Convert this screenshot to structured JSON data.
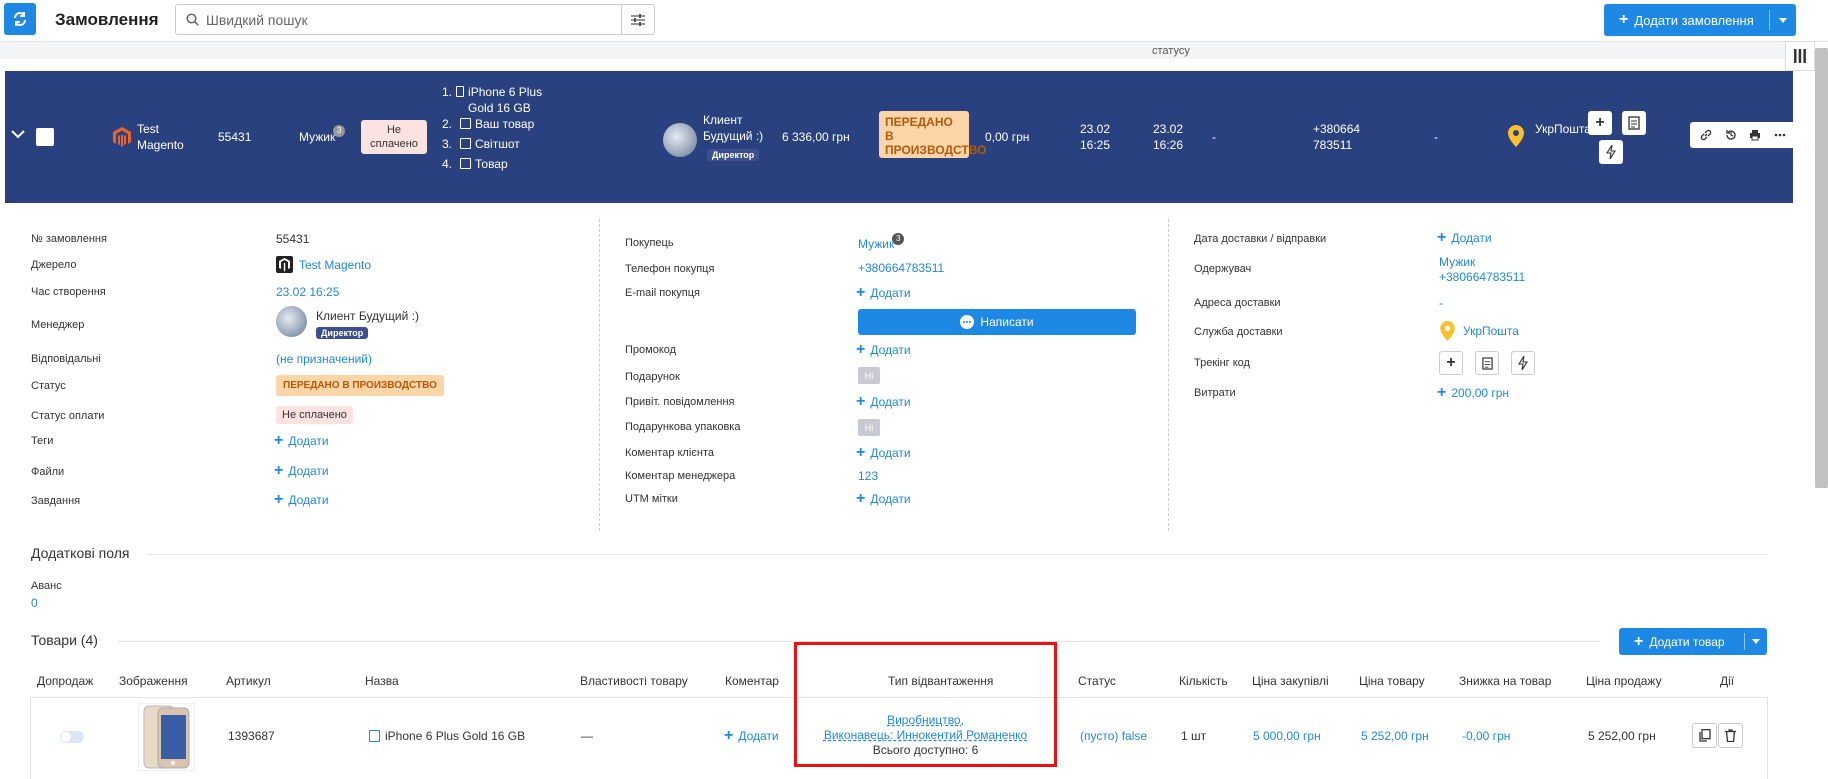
{
  "header": {
    "title": "Замовлення",
    "search_placeholder": "Швидкий пошук",
    "add_order_label": "Додати замовлення",
    "column_hint": "статусу"
  },
  "order": {
    "source": "Test Magento",
    "number": "55431",
    "customer": "Мужик",
    "customer_count": "3",
    "payment_status": "Не сплачено",
    "products": [
      {
        "n": "1.",
        "name": "iPhone 6 Plus Gold 16 GB"
      },
      {
        "n": "2.",
        "name": "Ваш товар"
      },
      {
        "n": "3.",
        "name": "Світшот"
      },
      {
        "n": "4.",
        "name": "Товар"
      }
    ],
    "manager": "Клиент Будущий :)",
    "manager_role": "Директор",
    "total": "6 336,00 грн",
    "status": "ПЕРЕДАНО В ПРОИЗВОДСТВО",
    "paid": "0,00 грн",
    "created": "23.02 16:25",
    "updated": "23.02 16:26",
    "dash1": "-",
    "phone": "+380664 783511",
    "dash2": "-",
    "delivery": "УкрПошта"
  },
  "details_left": {
    "labels": {
      "number": "№ замовлення",
      "source": "Джерело",
      "created": "Час створення",
      "manager": "Менеджер",
      "responsible": "Відповідальні",
      "status": "Статус",
      "pay_status": "Статус оплати",
      "tags": "Теги",
      "files": "Файли",
      "tasks": "Завдання"
    },
    "values": {
      "number": "55431",
      "source": "Test Magento",
      "created": "23.02 16:25",
      "manager": "Клиент Будущий :)",
      "role": "Директор",
      "responsible": "(не призначений)",
      "status": "ПЕРЕДАНО В ПРОИЗВОДСТВО",
      "pay_status": "Не сплачено",
      "add": "Додати"
    }
  },
  "details_mid": {
    "labels": {
      "buyer": "Покупець",
      "phone": "Телефон покупця",
      "email": "E-mail покупця",
      "promo": "Промокод",
      "gift": "Подарунок",
      "greeting": "Привіт. повідомлення",
      "giftwrap": "Подарункова упаковка",
      "client_comment": "Коментар клієнта",
      "manager_comment": "Коментар менеджера",
      "utm": "UTM мітки"
    },
    "values": {
      "buyer": "Мужик",
      "buyer_count": "3",
      "phone": "+380664783511",
      "add": "Додати",
      "write": "Написати",
      "no": "Ні",
      "manager_comment": "123"
    }
  },
  "details_right": {
    "labels": {
      "delivery_date": "Дата доставки / відправки",
      "recipient": "Одержувач",
      "address": "Адреса доставки",
      "service": "Служба доставки",
      "tracking": "Трекінг код",
      "costs": "Витрати"
    },
    "values": {
      "add": "Додати",
      "recipient_name": "Мужик",
      "recipient_phone": "+380664783511",
      "address": "-",
      "service": "УкрПошта",
      "costs": "200,00 грн"
    }
  },
  "extra": {
    "title": "Додаткові поля",
    "field_label": "Аванс",
    "field_value": "0"
  },
  "goods": {
    "title": "Товари (4)",
    "add_label": "Додати товар",
    "columns": [
      "Допродаж",
      "Зображення",
      "Артикул",
      "Назва",
      "Властивості товару",
      "Коментар",
      "Тип відвантаження",
      "Статус",
      "Кількість",
      "Ціна закупівлі",
      "Ціна товару",
      "Знижка на товар",
      "Ціна продажу",
      "Дії"
    ],
    "row": {
      "sku": "1393687",
      "name": "iPhone 6 Plus Gold 16 GB",
      "props": "—",
      "comment": "Додати",
      "ship_line1": "Виробництво,",
      "ship_line2": "Виконавець: Иннокентий Романенко",
      "ship_line3": "Всього доступно: 6",
      "status": "(пусто) false",
      "qty": "1 шт",
      "purchase": "5 000,00 грн",
      "price": "5 252,00 грн",
      "discount": "-0,00 грн",
      "sale": "5 252,00 грн"
    }
  },
  "colors": {
    "accent": "#1e88e5",
    "order_row": "#2a4180",
    "highlight": "#e11111"
  }
}
